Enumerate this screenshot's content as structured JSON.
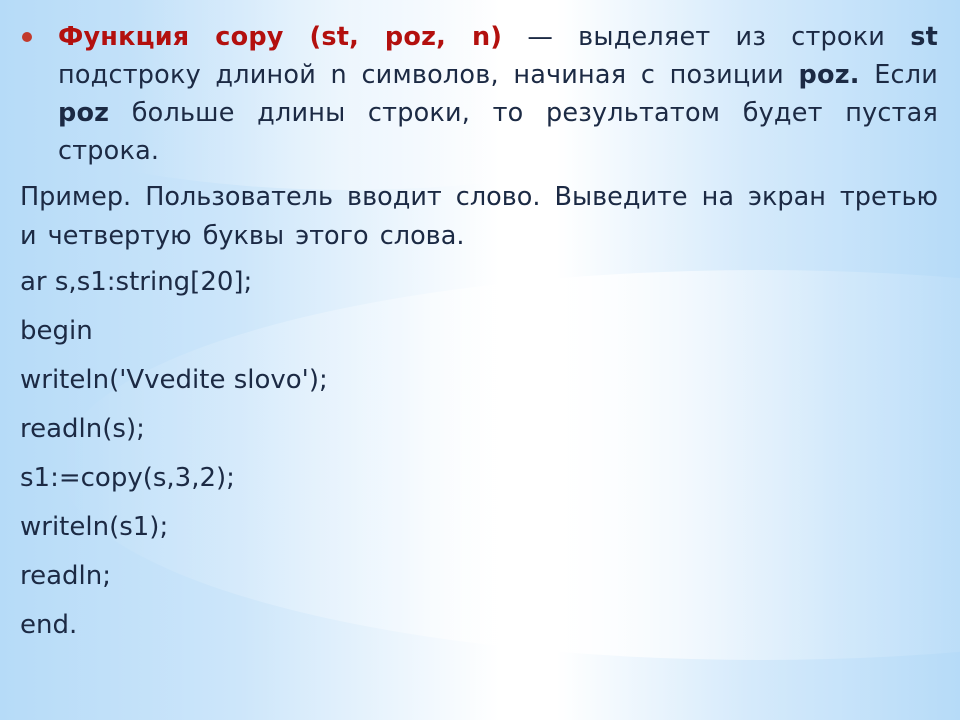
{
  "slide": {
    "bullet_paragraph": {
      "highlight": "Функция copy (st, poz, n)",
      "dash": " — выделяет из строки ",
      "st": "st",
      "mid": " подстроку длиной n символов, начиная с позиции ",
      "poz1": "poz.",
      "if_text": " Если ",
      "poz2": "poz",
      "tail": " больше длины строки, то результатом будет пустая строка."
    },
    "example": "Пример. Пользователь вводит слово. Выведите на экран третью и четвертую буквы этого слова.",
    "code_lines": [
      "ar s,s1:string[20];",
      "begin",
      "writeln('Vvedite slovo');",
      "readln(s);",
      "s1:=copy(s,3,2);",
      "writeln(s1);",
      "readln;",
      "end."
    ]
  },
  "colors": {
    "highlight": "#b3100e",
    "text": "#1c2a44",
    "bullet": "#c23a2c",
    "background": "#b5dbf7"
  }
}
